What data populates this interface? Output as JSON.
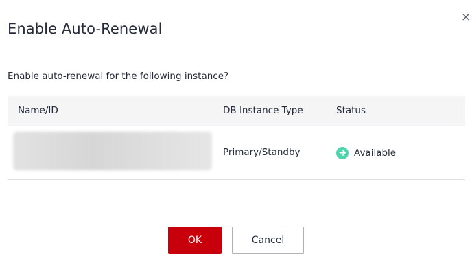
{
  "dialog": {
    "title": "Enable Auto-Renewal",
    "close_symbol": "×",
    "question": "Enable auto-renewal for the following instance?"
  },
  "table": {
    "headers": {
      "name": "Name/ID",
      "type": "DB Instance Type",
      "status": "Status"
    },
    "rows": [
      {
        "name_id": "",
        "type": "Primary/Standby",
        "status": "Available",
        "status_icon": "arrow-right-circle-icon"
      }
    ]
  },
  "buttons": {
    "ok_label": "OK",
    "cancel_label": "Cancel"
  },
  "colors": {
    "primary": "#c7000b",
    "status_available": "#50d4ab",
    "header_bg": "#f5f5f6"
  }
}
